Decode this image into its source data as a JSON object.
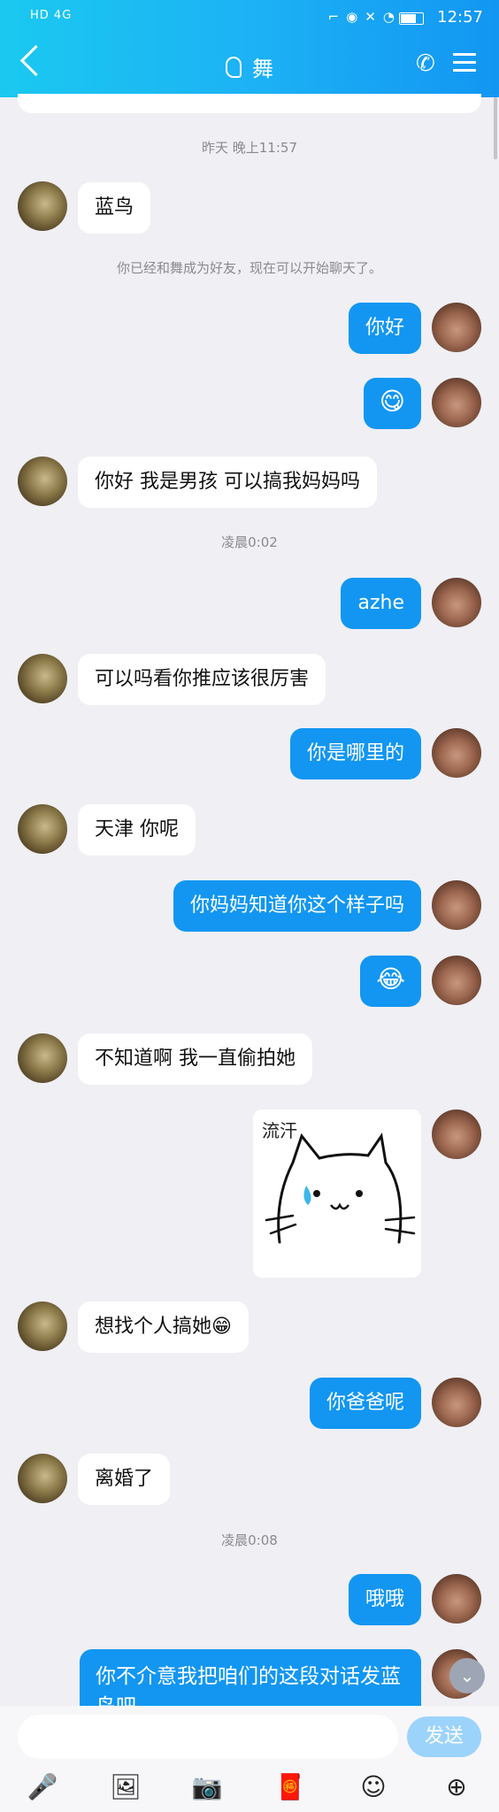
{
  "status_bar": {
    "network": "HD 4G",
    "time": "12:57"
  },
  "header": {
    "title": "舞",
    "back_icon": "back-arrow-icon",
    "call_icon": "phone-icon",
    "menu_icon": "menu-icon"
  },
  "messages": {
    "t1": "昨天 晚上11:57",
    "m1": "蓝鸟",
    "sys1": "你已经和舞成为好友，现在可以开始聊天了。",
    "m2": "你好",
    "m3": "😋",
    "m4": "你好 我是男孩 可以搞我妈妈吗",
    "t2": "凌晨0:02",
    "m5": "azhe",
    "m6": "可以吗看你推应该很厉害",
    "m7": "你是哪里的",
    "m8": "天津 你呢",
    "m9": "你妈妈知道你这个样子吗",
    "m10": "😂",
    "m11": "不知道啊 我一直偷拍她",
    "sticker_caption": "流汗",
    "m12": "想找个人搞她😁",
    "m13": "你爸爸呢",
    "m14": "离婚了",
    "t3": "凌晨0:08",
    "m15": "哦哦",
    "m16": "你不介意我把咱们的这段对话发蓝鸟吧"
  },
  "input": {
    "send_label": "发送",
    "placeholder": ""
  },
  "toolbar": {
    "voice_icon": "🎤",
    "image_icon": "🖼",
    "camera_icon": "📷",
    "redpacket_icon": "🧧",
    "emoji_icon": "☺",
    "plus_icon": "⊕"
  },
  "colors": {
    "accent": "#1296f2",
    "header_start": "#1ac9f0",
    "background": "#efeff4"
  }
}
